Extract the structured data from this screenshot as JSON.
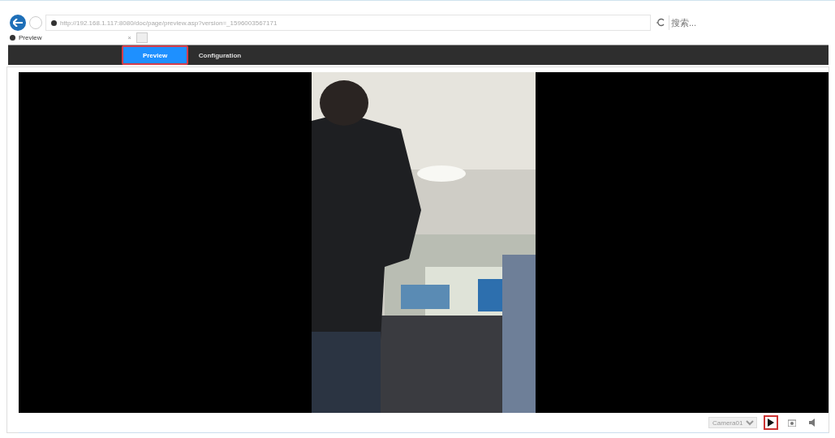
{
  "browser": {
    "url": "http://192.168.1.117:8080/doc/page/preview.asp?version=_1596003567171",
    "search": {
      "placeholder": "搜索..."
    },
    "tab": {
      "title": "Preview",
      "close": "×"
    }
  },
  "nav": {
    "tabs": [
      {
        "label": "Preview",
        "selected": true
      },
      {
        "label": "Configuration",
        "selected": false
      }
    ]
  },
  "preview": {
    "camera_select": "Camera01",
    "controls": [
      {
        "kind": "play",
        "highlighted": true
      },
      {
        "kind": "snapshot",
        "highlighted": false
      },
      {
        "kind": "volume",
        "highlighted": false
      }
    ]
  }
}
